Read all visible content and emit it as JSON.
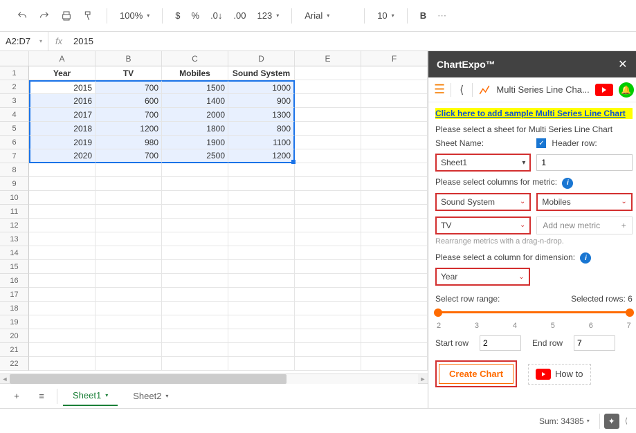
{
  "toolbar": {
    "zoom": "100%",
    "font": "Arial",
    "size": "10"
  },
  "fxbar": {
    "cellref": "A2:D7",
    "value": "2015"
  },
  "columns": [
    "A",
    "B",
    "C",
    "D",
    "E",
    "F"
  ],
  "rows": 22,
  "headers": [
    "Year",
    "TV",
    "Mobiles",
    "Sound System"
  ],
  "data": [
    [
      "2015",
      "700",
      "1500",
      "1000"
    ],
    [
      "2016",
      "600",
      "1400",
      "900"
    ],
    [
      "2017",
      "700",
      "2000",
      "1300"
    ],
    [
      "2018",
      "1200",
      "1800",
      "800"
    ],
    [
      "2019",
      "980",
      "1900",
      "1100"
    ],
    [
      "2020",
      "700",
      "2500",
      "1200"
    ]
  ],
  "tabs": {
    "sheet1": "Sheet1",
    "sheet2": "Sheet2"
  },
  "panel": {
    "title": "ChartExpo™",
    "chart_name": "Multi Series Line Cha...",
    "sample_link": "Click here to add sample Multi Series Line Chart",
    "instruct1": "Please select a sheet for Multi Series Line Chart",
    "sheet_label": "Sheet Name:",
    "sheet_value": "Sheet1",
    "header_row_label": "Header row:",
    "header_row_value": "1",
    "metric_label": "Please select columns for metric:",
    "metrics": [
      "Sound System",
      "Mobiles",
      "TV"
    ],
    "add_metric": "Add new metric",
    "rearrange_hint": "Rearrange metrics with a drag-n-drop.",
    "dim_label": "Please select a column for dimension:",
    "dim_value": "Year",
    "range_label": "Select row range:",
    "selected_rows": "Selected rows: 6",
    "ticks": [
      "2",
      "3",
      "4",
      "5",
      "6",
      "7"
    ],
    "start_label": "Start row",
    "start_value": "2",
    "end_label": "End row",
    "end_value": "7",
    "create_btn": "Create Chart",
    "howto": "How to"
  },
  "status": {
    "sum": "Sum: 34385"
  },
  "chart_data": {
    "type": "line",
    "title": "Multi Series Line Chart",
    "x_field": "Year",
    "categories": [
      "2015",
      "2016",
      "2017",
      "2018",
      "2019",
      "2020"
    ],
    "series": [
      {
        "name": "TV",
        "values": [
          700,
          600,
          700,
          1200,
          980,
          700
        ]
      },
      {
        "name": "Mobiles",
        "values": [
          1500,
          1400,
          2000,
          1800,
          1900,
          2500
        ]
      },
      {
        "name": "Sound System",
        "values": [
          1000,
          900,
          1300,
          800,
          1100,
          1200
        ]
      }
    ]
  }
}
